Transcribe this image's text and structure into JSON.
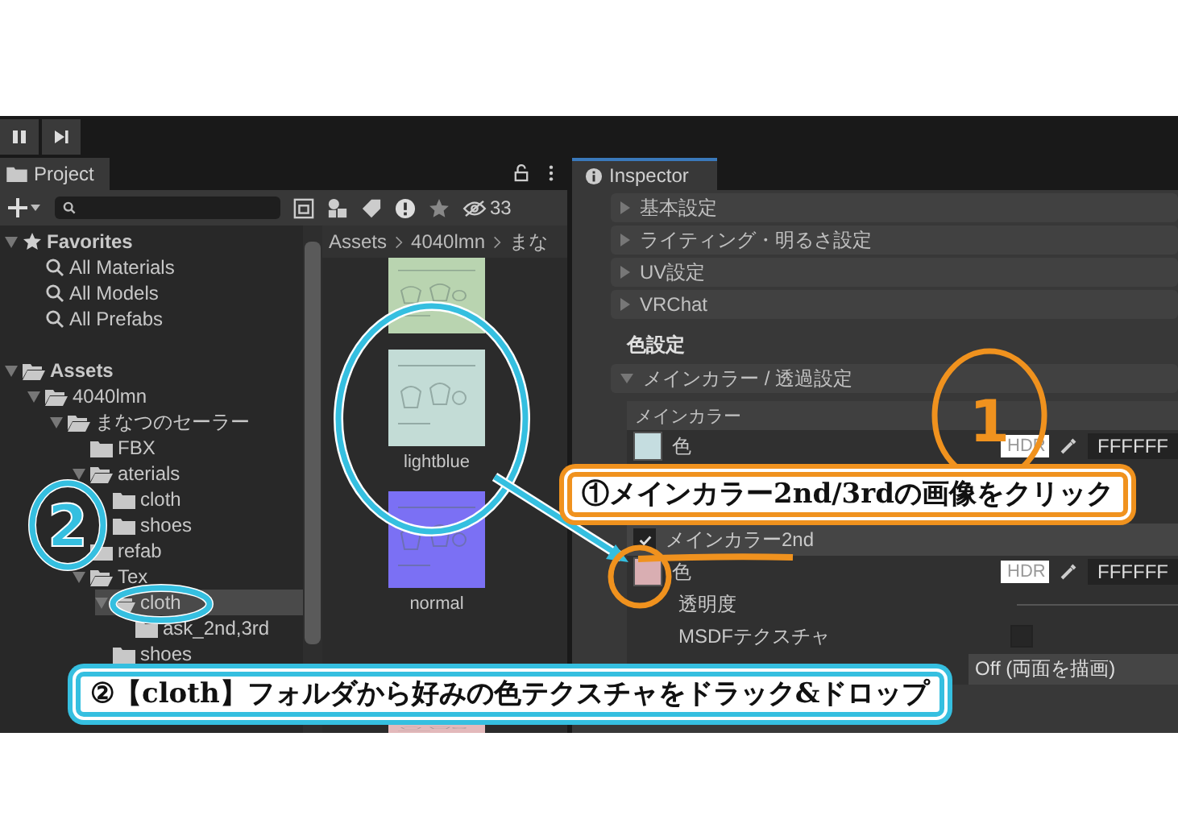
{
  "project": {
    "tab": "Project",
    "hidden_count": "33",
    "tree": [
      {
        "label": "Favorites",
        "kind": "favorites",
        "expanded": true,
        "selected": false,
        "children": [
          {
            "label": "All Materials",
            "kind": "search",
            "selected": false
          },
          {
            "label": "All Models",
            "kind": "search",
            "selected": false
          },
          {
            "label": "All Prefabs",
            "kind": "search",
            "selected": false
          }
        ]
      },
      {
        "label": "Assets",
        "kind": "folder",
        "expanded": true,
        "selected": false,
        "children": [
          {
            "label": "4040lmn",
            "kind": "folder",
            "expanded": true,
            "selected": false,
            "children": [
              {
                "label": "まなつのセーラー",
                "kind": "folder",
                "expanded": true,
                "selected": false,
                "children": [
                  {
                    "label": "FBX",
                    "kind": "folder",
                    "selected": false
                  },
                  {
                    "label": "aterials",
                    "kind": "folder",
                    "expanded": true,
                    "selected": false,
                    "children": [
                      {
                        "label": "cloth",
                        "kind": "folder",
                        "selected": false
                      },
                      {
                        "label": "shoes",
                        "kind": "folder",
                        "selected": false
                      }
                    ]
                  },
                  {
                    "label": "refab",
                    "kind": "folder",
                    "selected": false
                  },
                  {
                    "label": "Tex",
                    "kind": "folder",
                    "expanded": true,
                    "selected": false,
                    "children": [
                      {
                        "label": "cloth",
                        "kind": "folder",
                        "expanded": true,
                        "selected": true,
                        "children": [
                          {
                            "label": "ask_2nd,3rd",
                            "kind": "folder",
                            "selected": false
                          }
                        ]
                      },
                      {
                        "label": "shoes",
                        "kind": "folder",
                        "selected": false
                      }
                    ]
                  }
                ]
              }
            ]
          }
        ]
      }
    ],
    "breadcrumb": [
      "Assets",
      "4040lmn",
      "まな"
    ],
    "assets": [
      {
        "color": "#b9d4b0"
      },
      {
        "label": "lightblue",
        "color": "#c3dcd6"
      },
      {
        "label": "normal",
        "color": "#7b70f4"
      },
      {
        "color": "#e3b9bb"
      }
    ]
  },
  "inspector": {
    "tab": "Inspector",
    "foldouts": [
      {
        "label": "基本設定",
        "expanded": false
      },
      {
        "label": "ライティング・明るさ設定",
        "expanded": false
      },
      {
        "label": "UV設定",
        "expanded": false
      },
      {
        "label": "VRChat",
        "expanded": false
      }
    ],
    "section_title": "色設定",
    "main_foldout": {
      "label": "メインカラー / 透過設定",
      "expanded": true
    },
    "main_color": {
      "title": "メインカラー",
      "label": "色",
      "hdr": "HDR",
      "hex": "FFFFFF"
    },
    "second": {
      "label": "メインカラー2nd",
      "checked": true,
      "rows": [
        {
          "kind": "color",
          "label": "色",
          "hdr": "HDR",
          "hex": "FFFFFF"
        },
        {
          "kind": "label",
          "label": "透明度"
        },
        {
          "kind": "toggle",
          "label": "MSDFテクスチャ",
          "checked": false
        },
        {
          "kind": "dropdown",
          "value": "Off (両面を描画)"
        }
      ]
    }
  },
  "annotations": {
    "callouts": [
      {
        "text": "①メインカラー2nd/3rdの画像をクリック",
        "color": "#f0921e"
      },
      {
        "text": "②【cloth】フォルダから好みの色テクスチャをドラック&ドロップ",
        "color": "#35bfe0"
      }
    ],
    "marks": [
      {
        "text": "1",
        "color": "#f0921e"
      },
      {
        "text": "2",
        "color": "#35bfe0"
      }
    ]
  }
}
